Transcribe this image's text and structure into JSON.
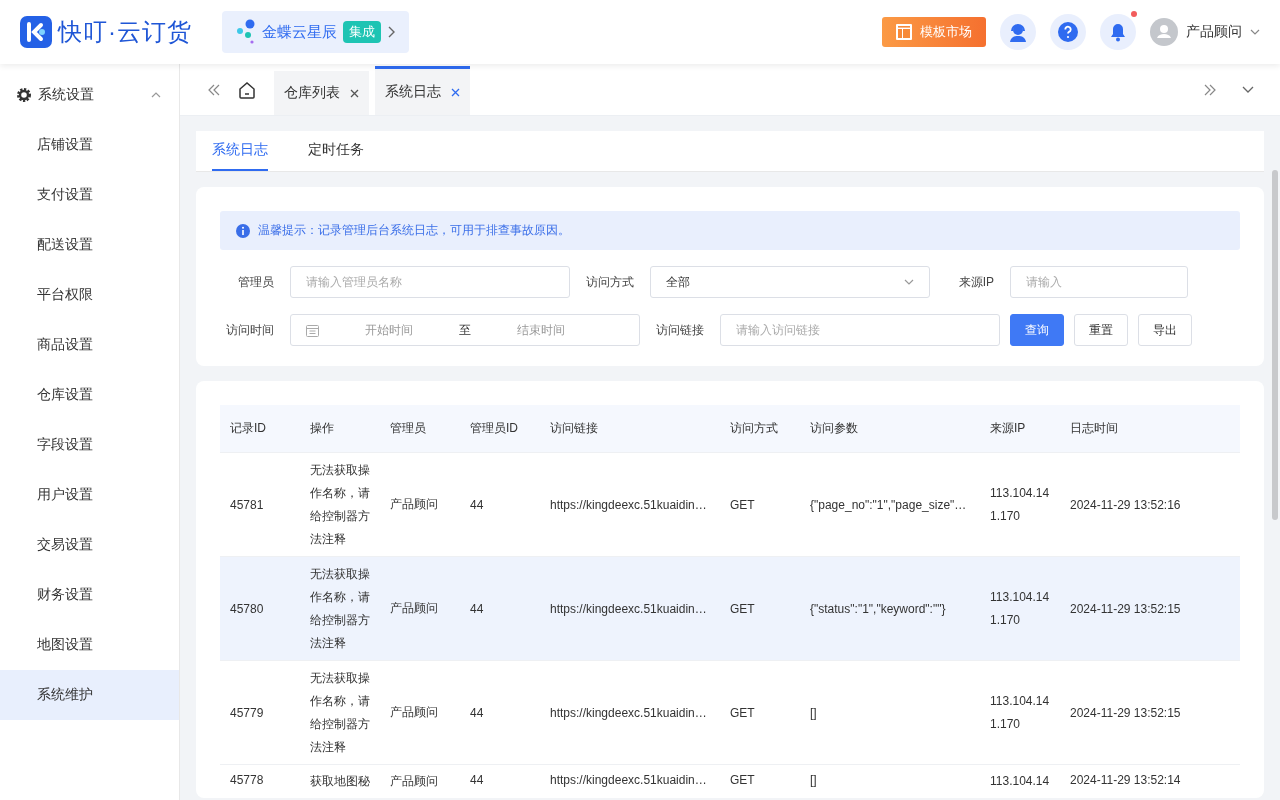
{
  "header": {
    "logo": "快叮·云订货",
    "promo": {
      "label": "金蝶云星辰",
      "badge": "集成"
    },
    "template_button": "模板市场",
    "notification_dot": true,
    "user": "产品顾问"
  },
  "sidebar": {
    "group": {
      "label": "系统设置",
      "expanded": true
    },
    "items": [
      {
        "label": "店铺设置",
        "selected": false
      },
      {
        "label": "支付设置",
        "selected": false
      },
      {
        "label": "配送设置",
        "selected": false
      },
      {
        "label": "平台权限",
        "selected": false
      },
      {
        "label": "商品设置",
        "selected": false
      },
      {
        "label": "仓库设置",
        "selected": false
      },
      {
        "label": "字段设置",
        "selected": false
      },
      {
        "label": "用户设置",
        "selected": false
      },
      {
        "label": "交易设置",
        "selected": false
      },
      {
        "label": "财务设置",
        "selected": false
      },
      {
        "label": "地图设置",
        "selected": false
      },
      {
        "label": "系统维护",
        "selected": true
      }
    ]
  },
  "page_tabs": [
    {
      "label": "仓库列表",
      "selected": false
    },
    {
      "label": "系统日志",
      "selected": true
    }
  ],
  "sub_tabs": [
    {
      "label": "系统日志",
      "selected": true
    },
    {
      "label": "定时任务",
      "selected": false
    }
  ],
  "notice": "温馨提示：记录管理后台系统日志，可用于排查事故原因。",
  "filters": {
    "admin": {
      "label": "管理员",
      "placeholder": "请输入管理员名称"
    },
    "method": {
      "label": "访问方式",
      "value": "全部"
    },
    "ip": {
      "label": "来源IP",
      "placeholder": "请输入"
    },
    "time": {
      "label": "访问时间",
      "start_placeholder": "开始时间",
      "separator": "至",
      "end_placeholder": "结束时间"
    },
    "link": {
      "label": "访问链接",
      "placeholder": "请输入访问链接"
    }
  },
  "buttons": [
    {
      "label": "查询",
      "kind": "primary"
    },
    {
      "label": "重置",
      "kind": "default"
    },
    {
      "label": "导出",
      "kind": "default"
    }
  ],
  "table": {
    "columns": [
      "记录ID",
      "操作",
      "管理员",
      "管理员ID",
      "访问链接",
      "访问方式",
      "访问参数",
      "来源IP",
      "日志时间"
    ],
    "rows": [
      {
        "selected": false,
        "cells": [
          "45781",
          "无法获取操作名称，请给控制器方法注释",
          "产品顾问",
          "44",
          "https://kingdeexc.51kuaidin…",
          "GET",
          "{\"page_no\":\"1\",\"page_size\"…",
          "113.104.141.170",
          "2024-11-29 13:52:16"
        ]
      },
      {
        "selected": true,
        "cells": [
          "45780",
          "无法获取操作名称，请给控制器方法注释",
          "产品顾问",
          "44",
          "https://kingdeexc.51kuaidin…",
          "GET",
          "{\"status\":\"1\",\"keyword\":\"\"}",
          "113.104.141.170",
          "2024-11-29 13:52:15"
        ]
      },
      {
        "selected": false,
        "cells": [
          "45779",
          "无法获取操作名称，请给控制器方法注释",
          "产品顾问",
          "44",
          "https://kingdeexc.51kuaidin…",
          "GET",
          "[]",
          "113.104.141.170",
          "2024-11-29 13:52:15"
        ]
      },
      {
        "selected": false,
        "cells": [
          "45778",
          "获取地图秘",
          "产品顾问",
          "44",
          "https://kingdeexc.51kuaidin…",
          "GET",
          "[]",
          "113.104.14",
          "2024-11-29 13:52:14"
        ]
      }
    ]
  }
}
